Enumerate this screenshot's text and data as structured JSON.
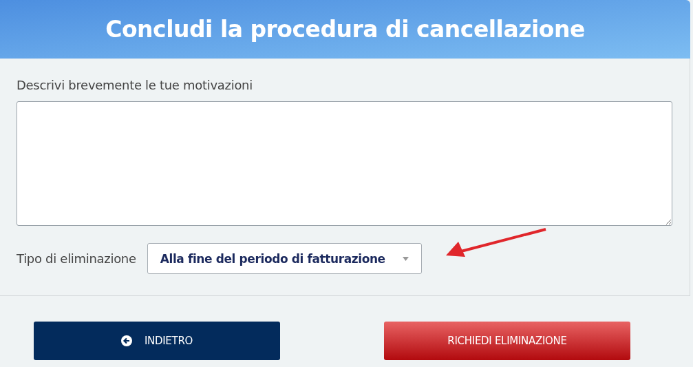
{
  "header": {
    "title": "Concludi la procedura di cancellazione"
  },
  "reason_field": {
    "label": "Descrivi brevemente le tue motivazioni"
  },
  "deletion_type": {
    "label": "Tipo di eliminazione",
    "value": "Alla fine del periodo di fatturazione"
  },
  "buttons": [
    {
      "kind": "back",
      "label": "INDIETRO"
    },
    {
      "kind": "danger",
      "label": "RICHIEDI ELIMINAZIONE"
    }
  ]
}
